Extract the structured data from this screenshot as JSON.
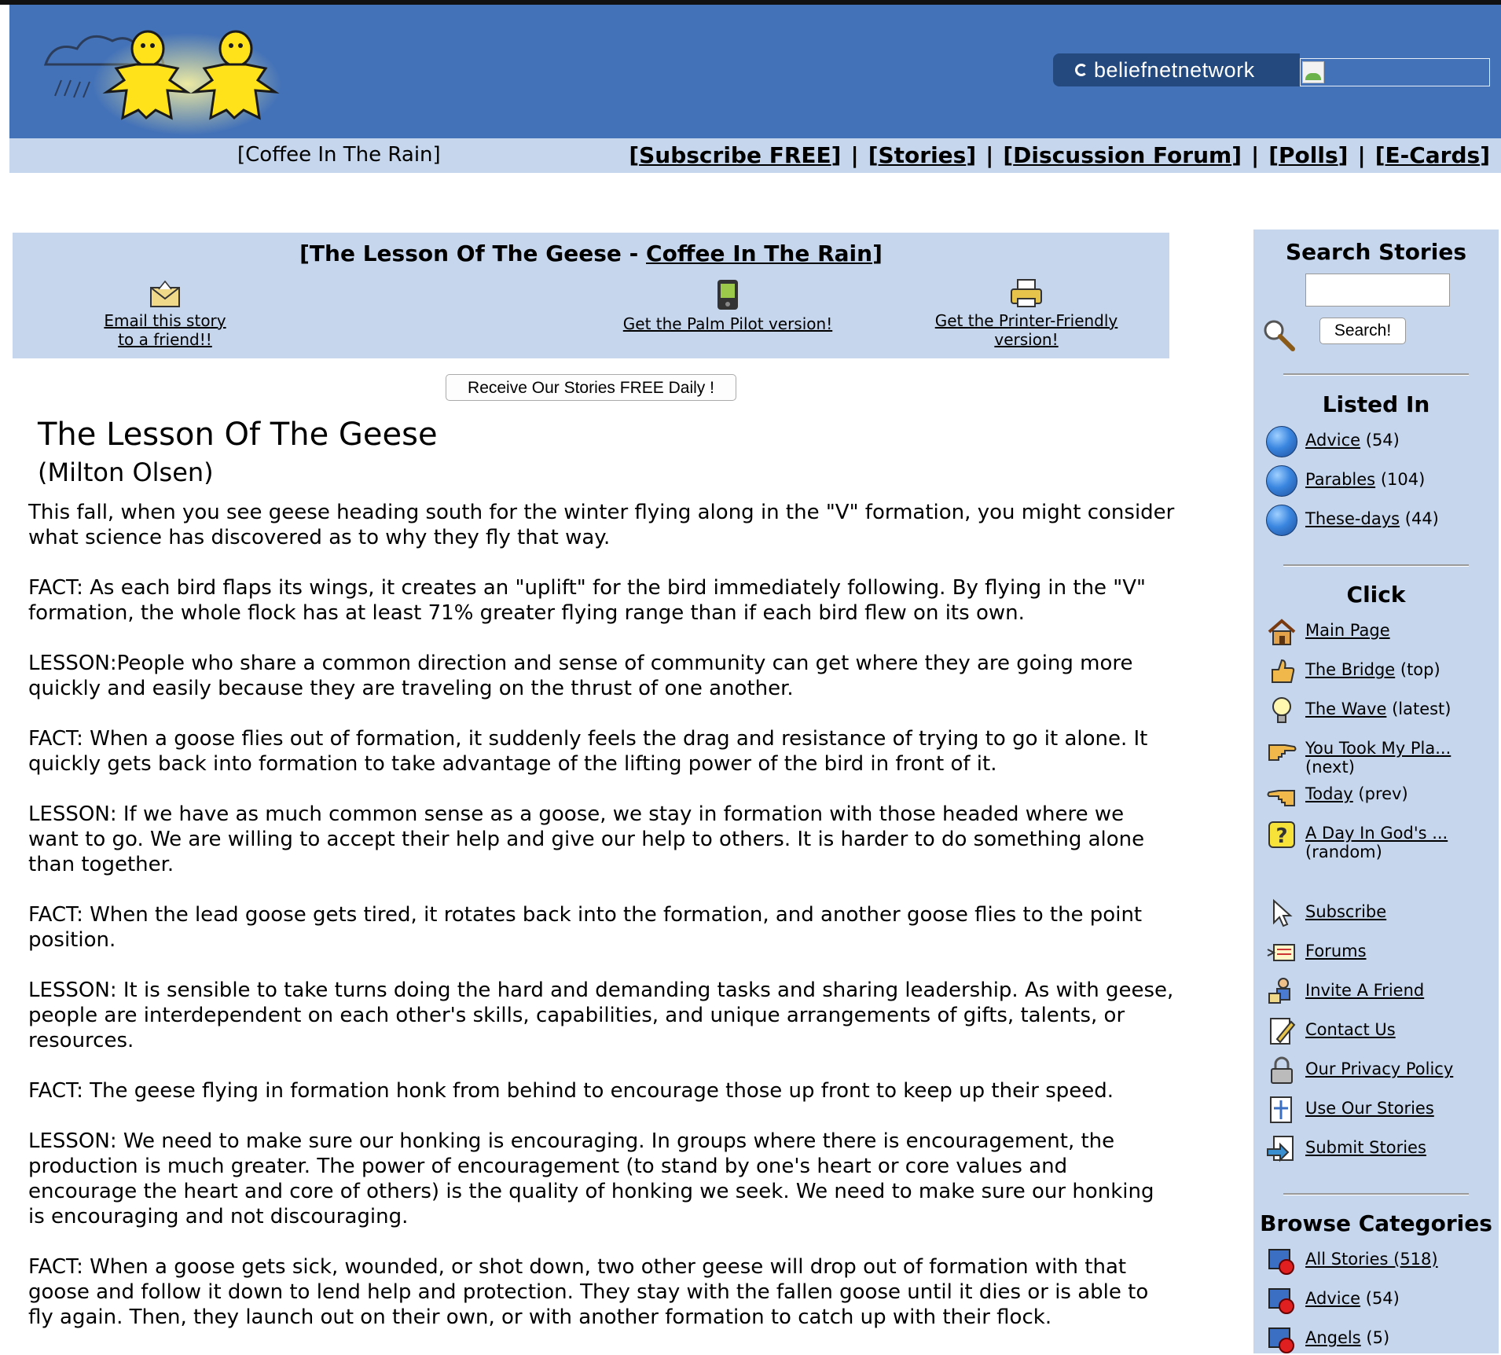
{
  "header": {
    "network_prefix": "beliefnet",
    "network_suffix": "network",
    "colors": {
      "banner": "#4472b8",
      "nav": "#c5d6ed",
      "sidebar": "#c5d6ed"
    }
  },
  "nav": {
    "site_name": "[Coffee In The Rain]",
    "links": [
      {
        "label": "Subscribe FREE"
      },
      {
        "label": "Stories"
      },
      {
        "label": "Discussion Forum"
      },
      {
        "label": "Polls"
      },
      {
        "label": "E-Cards"
      }
    ]
  },
  "story_header": {
    "title_prefix": "[The Lesson Of The Geese - ",
    "title_link": "Coffee In The Rain",
    "title_suffix": "]",
    "email_line1": "Email this story",
    "email_line2": "to a friend!!",
    "palm": "Get the Palm Pilot version!",
    "printer_line1": "Get the Printer-Friendly",
    "printer_line2": "version!"
  },
  "receive_button": "Receive Our Stories FREE Daily !",
  "article": {
    "title": "The Lesson Of The Geese",
    "author": "(Milton Olsen)",
    "paragraphs": [
      "This fall, when you see geese heading south for the winter flying along in the \"V\" formation, you might consider what science has discovered as to why they fly that way.",
      "FACT: As each bird flaps its wings, it creates an \"uplift\" for the bird immediately following. By flying in the \"V\" formation, the whole flock has at least 71% greater flying range than if each bird flew on its own.",
      "LESSON:People who share a common direction and sense of community can get where they are going more quickly and easily because they are traveling on the thrust of one another.",
      "FACT: When a goose flies out of formation, it suddenly feels the drag and resistance of trying to go it alone. It quickly gets back into formation to take advantage of the lifting power of the bird in front of it.",
      "LESSON: If we have as much common sense as a goose, we stay in formation with those headed where we want to go. We are willing to accept their help and give our help to others. It is harder to do something alone than together.",
      "FACT: When the lead goose gets tired, it rotates back into the formation, and another goose flies to the point position.",
      "LESSON: It is sensible to take turns doing the hard and demanding tasks and sharing leadership. As with geese, people are interdependent on each other's skills, capabilities, and unique arrangements of gifts, talents, or resources.",
      "FACT: The geese flying in formation honk from behind to encourage those up front to keep up their speed.",
      "LESSON: We need to make sure our honking is encouraging. In groups where there is encouragement, the production is much greater. The power of encouragement (to stand by one's heart or core values and encourage the heart and core of others) is the quality of honking we seek. We need to make sure our honking is encouraging and not discouraging.",
      "FACT: When a goose gets sick, wounded, or shot down, two other geese will drop out of formation with that goose and follow it down to lend help and protection. They stay with the fallen goose until it dies or is able to fly again. Then, they launch out on their own, or with another formation to catch up with their flock."
    ]
  },
  "sidebar": {
    "search_title": "Search Stories",
    "search_button": "Search!",
    "listed_title": "Listed In",
    "listed": [
      {
        "label": "Advice",
        "count": "(54)"
      },
      {
        "label": "Parables",
        "count": "(104)"
      },
      {
        "label": "These-days",
        "count": "(44)"
      }
    ],
    "click_title": "Click",
    "click": [
      {
        "label": "Main Page",
        "note": "",
        "icon": "house-icon"
      },
      {
        "label": "The Bridge",
        "note": "(top)",
        "icon": "thumbs-up-icon"
      },
      {
        "label": "The Wave",
        "note": "(latest)",
        "icon": "lightbulb-icon"
      },
      {
        "label": "You Took My Pla...",
        "note": "(next)",
        "icon": "hand-right-icon"
      },
      {
        "label": "Today",
        "note": "(prev)",
        "icon": "hand-left-icon"
      },
      {
        "label": "A Day In God's ...",
        "note": "(random)",
        "icon": "question-icon"
      }
    ],
    "links": [
      {
        "label": "Subscribe",
        "icon": "cursor-icon"
      },
      {
        "label": "Forums",
        "icon": "forum-icon"
      },
      {
        "label": "Invite A Friend",
        "icon": "invite-icon"
      },
      {
        "label": "Contact Us",
        "icon": "contact-icon"
      },
      {
        "label": "Our Privacy Policy",
        "icon": "lock-icon"
      },
      {
        "label": "Use Our Stories",
        "icon": "use-stories-icon"
      },
      {
        "label": "Submit Stories",
        "icon": "submit-icon"
      }
    ],
    "browse_title": "Browse Categories",
    "browse": [
      {
        "label": "All Stories (518)",
        "count": ""
      },
      {
        "label": "Advice",
        "count": "(54)"
      },
      {
        "label": "Angels",
        "count": "(5)"
      }
    ]
  }
}
